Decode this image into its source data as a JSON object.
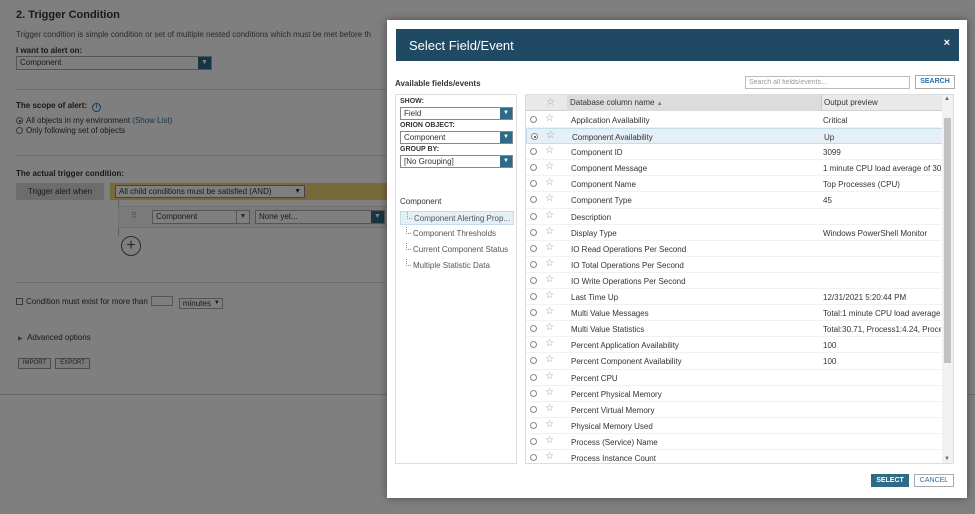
{
  "background": {
    "title": "2. Trigger Condition",
    "description": "Trigger condition is simple condition or set of multiple nested conditions which must be met before th",
    "alert_on_label": "I want to alert on:",
    "alert_on_value": "Component",
    "scope_label": "The scope of alert:",
    "scope_all": "All objects in my environment",
    "show_list": "(Show List)",
    "scope_following": "Only following set of objects",
    "trigger_label": "The actual trigger condition:",
    "trigger_button": "Trigger alert when",
    "condition_value": "All child conditions must be satisfied (AND)",
    "field_value": "Component",
    "operator_value": "None yet...",
    "exist_label": "Condition must exist for more than",
    "minutes_value": "minutes",
    "advanced_options": "Advanced options",
    "import_label": "IMPORT",
    "export_label": "EXPORT"
  },
  "dialog": {
    "title": "Select Field/Event",
    "close": "×",
    "available_label": "Available fields/events",
    "search_placeholder": "Search all fields/events...",
    "search_button": "SEARCH",
    "show_label": "SHOW:",
    "show_value": "Field",
    "orion_label": "ORION OBJECT:",
    "orion_value": "Component",
    "group_label": "GROUP BY:",
    "group_value": "[No Grouping]",
    "tree_root": "Component",
    "tree_items": [
      "Component Alerting Prop...",
      "Component Thresholds",
      "Current Component Status",
      "Multiple Statistic Data"
    ],
    "col_name": "Database column name",
    "col_preview": "Output preview",
    "rows": [
      {
        "name": "Application Availability",
        "preview": "Critical"
      },
      {
        "name": "Component Availability",
        "preview": "Up"
      },
      {
        "name": "Component ID",
        "preview": "3099"
      },
      {
        "name": "Component Message",
        "preview": "1 minute CPU load average of 30"
      },
      {
        "name": "Component Name",
        "preview": "Top Processes (CPU)"
      },
      {
        "name": "Component Type",
        "preview": "45"
      },
      {
        "name": "Description",
        "preview": ""
      },
      {
        "name": "Display Type",
        "preview": "Windows PowerShell Monitor"
      },
      {
        "name": "IO Read Operations Per Second",
        "preview": ""
      },
      {
        "name": "IO Total Operations Per Second",
        "preview": ""
      },
      {
        "name": "IO Write Operations Per Second",
        "preview": ""
      },
      {
        "name": "Last Time Up",
        "preview": "12/31/2021 5:20:44 PM"
      },
      {
        "name": "Multi Value Messages",
        "preview": "Total:1 minute CPU load average"
      },
      {
        "name": "Multi Value Statistics",
        "preview": "Total:30.71, Process1:4.24, Proce"
      },
      {
        "name": "Percent Application Availability",
        "preview": "100"
      },
      {
        "name": "Percent Component Availability",
        "preview": "100"
      },
      {
        "name": "Percent CPU",
        "preview": ""
      },
      {
        "name": "Percent Physical Memory",
        "preview": ""
      },
      {
        "name": "Percent Virtual Memory",
        "preview": ""
      },
      {
        "name": "Physical Memory Used",
        "preview": ""
      },
      {
        "name": "Process (Service) Name",
        "preview": ""
      },
      {
        "name": "Process Instance Count",
        "preview": ""
      }
    ],
    "selected_row": 1,
    "select_button": "SELECT",
    "cancel_button": "CANCEL"
  }
}
